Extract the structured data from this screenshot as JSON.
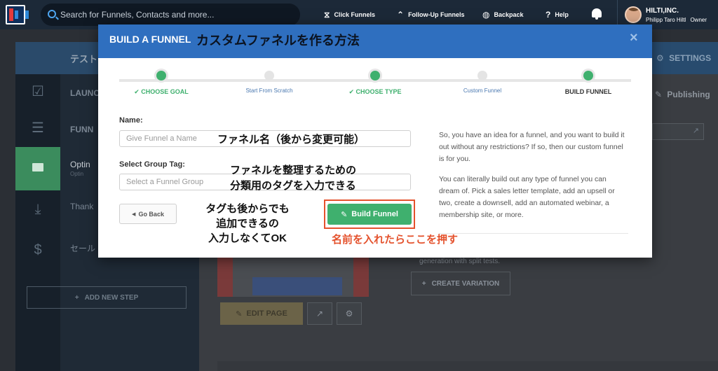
{
  "topbar": {
    "search_placeholder": "Search for Funnels, Contacts and more...",
    "nav": {
      "click_funnels": "Click Funnels",
      "follow_up_funnels": "Follow-Up Funnels",
      "backpack": "Backpack",
      "help": "Help"
    },
    "account": {
      "company": "HILTI,INC.",
      "user": "Philipp Taro Hiltl",
      "role": "Owner"
    }
  },
  "background": {
    "funnel_title": "テスト",
    "settings": "SETTINGS",
    "publishing": "Publishing",
    "steps": [
      {
        "label": "LAUNC"
      },
      {
        "label": "FUNN"
      },
      {
        "label": "Optin",
        "sub": "Optin"
      },
      {
        "label": "Thank"
      },
      {
        "label": "セール"
      }
    ],
    "add_new_step": "ADD NEW STEP",
    "edit_page": "EDIT PAGE",
    "create_variation": "CREATE VARIATION",
    "lead_text": "generation with split tests."
  },
  "modal": {
    "title": "BUILD A FUNNEL",
    "title_annotation": "カスタムファネルを作る方法",
    "close": "×",
    "steps": [
      {
        "label": "CHOOSE GOAL",
        "state": "done"
      },
      {
        "label": "Start From Scratch",
        "state": "todo"
      },
      {
        "label": "CHOOSE TYPE",
        "state": "done"
      },
      {
        "label": "Custom Funnel",
        "state": "todo"
      },
      {
        "label": "BUILD FUNNEL",
        "state": "current"
      }
    ],
    "name_label": "Name:",
    "name_placeholder": "Give Funnel a Name",
    "name_annotation": "ファネル名（後から変更可能）",
    "group_label": "Select Group Tag:",
    "group_placeholder": "Select a Funnel Group",
    "group_annotation_1": "ファネルを整理するための",
    "group_annotation_2": "分類用のタグを入力できる",
    "back_button": "Go Back",
    "tag_annotation_1": "タグも後からでも",
    "tag_annotation_2": "追加できるの",
    "tag_annotation_3": "入力しなくてOK",
    "build_button": "Build Funnel",
    "build_annotation": "名前を入れたらここを押す",
    "description_1": "So, you have an idea for a funnel, and you want to build it out without any restrictions? If so, then our custom funnel is for you.",
    "description_2": "You can literally build out any type of funnel you can dream of. Pick a sales letter template, add an upsell or two, create a downsell, add an automated webinar, a membership site, or more."
  },
  "colors": {
    "topbar": "#1c2938",
    "modal_header": "#2f6fbf",
    "success_green": "#3fb06e",
    "annotation_red": "#e4522d"
  }
}
